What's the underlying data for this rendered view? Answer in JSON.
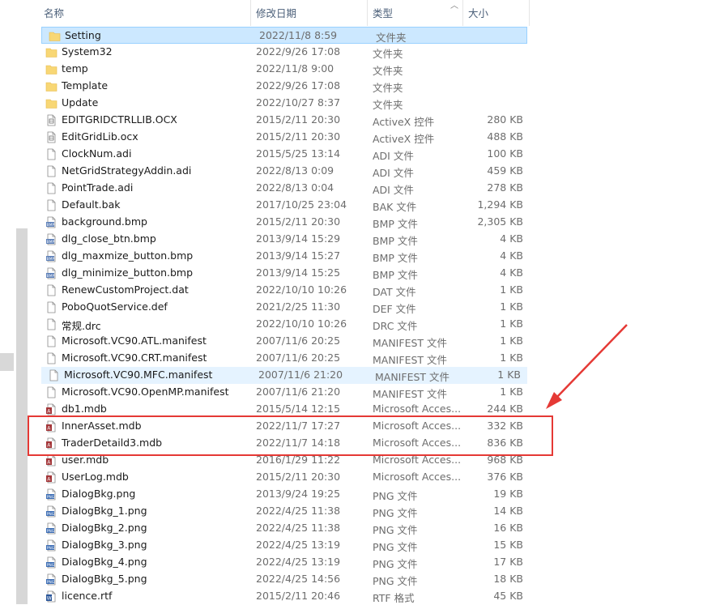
{
  "columns": {
    "name": "名称",
    "date": "修改日期",
    "type": "类型",
    "size": "大小"
  },
  "files": [
    {
      "name": "Setting",
      "date": "2022/11/8 8:59",
      "type": "文件夹",
      "size": "",
      "icon": "folder-icon",
      "state": "selected"
    },
    {
      "name": "System32",
      "date": "2022/9/26 17:08",
      "type": "文件夹",
      "size": "",
      "icon": "folder-icon"
    },
    {
      "name": "temp",
      "date": "2022/11/8 9:00",
      "type": "文件夹",
      "size": "",
      "icon": "folder-icon"
    },
    {
      "name": "Template",
      "date": "2022/9/26 17:08",
      "type": "文件夹",
      "size": "",
      "icon": "folder-icon"
    },
    {
      "name": "Update",
      "date": "2022/10/27 8:37",
      "type": "文件夹",
      "size": "",
      "icon": "folder-icon"
    },
    {
      "name": "EDITGRIDCTRLLIB.OCX",
      "date": "2015/2/11 20:30",
      "type": "ActiveX 控件",
      "size": "280 KB",
      "icon": "activex-file-icon"
    },
    {
      "name": "EditGridLib.ocx",
      "date": "2015/2/11 20:30",
      "type": "ActiveX 控件",
      "size": "488 KB",
      "icon": "activex-file-icon"
    },
    {
      "name": "ClockNum.adi",
      "date": "2015/5/25 13:14",
      "type": "ADI 文件",
      "size": "100 KB",
      "icon": "generic-file-icon"
    },
    {
      "name": "NetGridStrategyAddin.adi",
      "date": "2022/8/13 0:09",
      "type": "ADI 文件",
      "size": "459 KB",
      "icon": "generic-file-icon"
    },
    {
      "name": "PointTrade.adi",
      "date": "2022/8/13 0:04",
      "type": "ADI 文件",
      "size": "278 KB",
      "icon": "generic-file-icon"
    },
    {
      "name": "Default.bak",
      "date": "2017/10/25 23:04",
      "type": "BAK 文件",
      "size": "1,294 KB",
      "icon": "generic-file-icon"
    },
    {
      "name": "background.bmp",
      "date": "2015/2/11 20:30",
      "type": "BMP 文件",
      "size": "2,305 KB",
      "icon": "bmp-file-icon"
    },
    {
      "name": "dlg_close_btn.bmp",
      "date": "2013/9/14 15:29",
      "type": "BMP 文件",
      "size": "4 KB",
      "icon": "bmp-file-icon"
    },
    {
      "name": "dlg_maxmize_button.bmp",
      "date": "2013/9/14 15:27",
      "type": "BMP 文件",
      "size": "4 KB",
      "icon": "bmp-file-icon"
    },
    {
      "name": "dlg_minimize_button.bmp",
      "date": "2013/9/14 15:25",
      "type": "BMP 文件",
      "size": "4 KB",
      "icon": "bmp-file-icon"
    },
    {
      "name": "RenewCustomProject.dat",
      "date": "2022/10/10 10:26",
      "type": "DAT 文件",
      "size": "1 KB",
      "icon": "generic-file-icon"
    },
    {
      "name": "PoboQuotService.def",
      "date": "2021/2/25 11:30",
      "type": "DEF 文件",
      "size": "1 KB",
      "icon": "generic-file-icon"
    },
    {
      "name": "常规.drc",
      "date": "2022/10/10 10:26",
      "type": "DRC 文件",
      "size": "1 KB",
      "icon": "generic-file-icon"
    },
    {
      "name": "Microsoft.VC90.ATL.manifest",
      "date": "2007/11/6 20:25",
      "type": "MANIFEST 文件",
      "size": "1 KB",
      "icon": "generic-file-icon"
    },
    {
      "name": "Microsoft.VC90.CRT.manifest",
      "date": "2007/11/6 20:25",
      "type": "MANIFEST 文件",
      "size": "1 KB",
      "icon": "generic-file-icon"
    },
    {
      "name": "Microsoft.VC90.MFC.manifest",
      "date": "2007/11/6 21:20",
      "type": "MANIFEST 文件",
      "size": "1 KB",
      "icon": "generic-file-icon",
      "state": "hover"
    },
    {
      "name": "Microsoft.VC90.OpenMP.manifest",
      "date": "2007/11/6 21:20",
      "type": "MANIFEST 文件",
      "size": "1 KB",
      "icon": "generic-file-icon"
    },
    {
      "name": "db1.mdb",
      "date": "2015/5/14 12:15",
      "type": "Microsoft Acces...",
      "size": "244 KB",
      "icon": "access-db-icon"
    },
    {
      "name": "InnerAsset.mdb",
      "date": "2022/11/7 17:27",
      "type": "Microsoft Acces...",
      "size": "332 KB",
      "icon": "access-db-icon"
    },
    {
      "name": "TraderDetaild3.mdb",
      "date": "2022/11/7 14:18",
      "type": "Microsoft Acces...",
      "size": "836 KB",
      "icon": "access-db-icon"
    },
    {
      "name": "user.mdb",
      "date": "2016/1/29 11:22",
      "type": "Microsoft Acces...",
      "size": "968 KB",
      "icon": "access-db-icon"
    },
    {
      "name": "UserLog.mdb",
      "date": "2015/2/11 20:30",
      "type": "Microsoft Acces...",
      "size": "376 KB",
      "icon": "access-db-icon"
    },
    {
      "name": "DialogBkg.png",
      "date": "2013/9/24 19:25",
      "type": "PNG 文件",
      "size": "19 KB",
      "icon": "png-file-icon"
    },
    {
      "name": "DialogBkg_1.png",
      "date": "2022/4/25 11:38",
      "type": "PNG 文件",
      "size": "14 KB",
      "icon": "png-file-icon"
    },
    {
      "name": "DialogBkg_2.png",
      "date": "2022/4/25 11:38",
      "type": "PNG 文件",
      "size": "16 KB",
      "icon": "png-file-icon"
    },
    {
      "name": "DialogBkg_3.png",
      "date": "2022/4/25 13:19",
      "type": "PNG 文件",
      "size": "15 KB",
      "icon": "png-file-icon"
    },
    {
      "name": "DialogBkg_4.png",
      "date": "2022/4/25 13:19",
      "type": "PNG 文件",
      "size": "17 KB",
      "icon": "png-file-icon"
    },
    {
      "name": "DialogBkg_5.png",
      "date": "2022/4/25 14:56",
      "type": "PNG 文件",
      "size": "18 KB",
      "icon": "png-file-icon"
    },
    {
      "name": "licence.rtf",
      "date": "2015/2/11 20:46",
      "type": "RTF 格式",
      "size": "45 KB",
      "icon": "rtf-file-icon"
    }
  ],
  "colors": {
    "selected_bg": "#cce8ff",
    "hover_bg": "#e5f3ff",
    "annotation_red": "#e53935",
    "folder": "#f8d775"
  }
}
